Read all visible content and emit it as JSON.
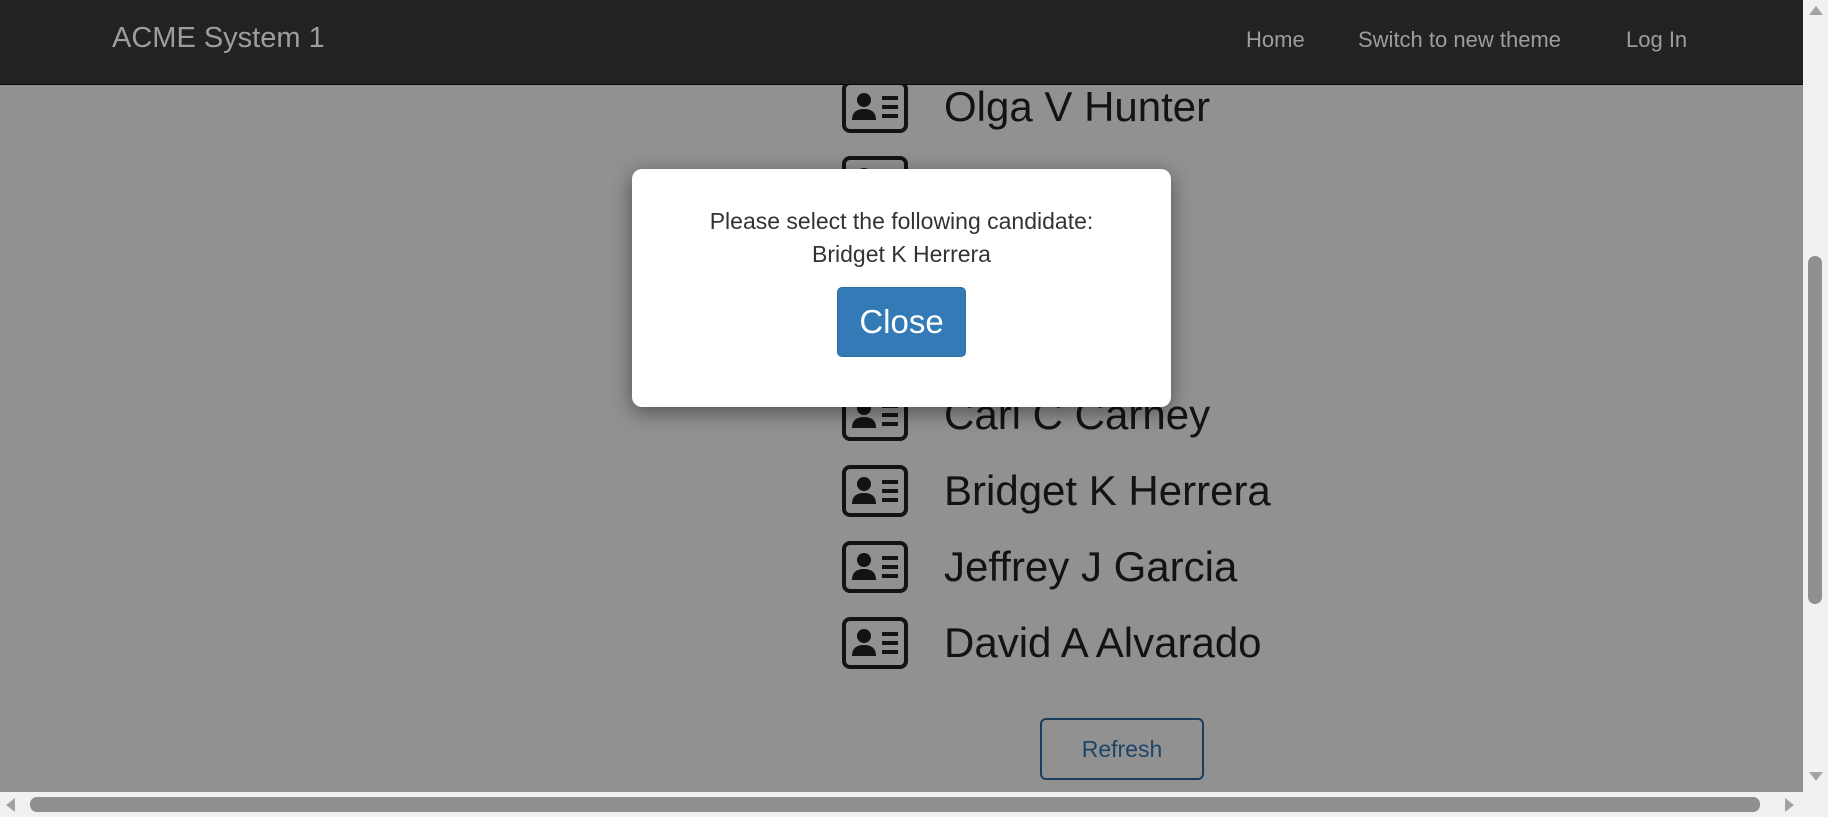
{
  "navbar": {
    "brand": "ACME System 1",
    "links": [
      "Home",
      "Switch to new theme",
      "Log In"
    ]
  },
  "candidates": [
    {
      "name": "Olga V Hunter",
      "icon": "id-card-icon"
    },
    {
      "name": "",
      "icon": "id-card-icon"
    },
    {
      "name": "Carl C Carney",
      "icon": "id-card-icon"
    },
    {
      "name": "Bridget K Herrera",
      "icon": "id-card-icon"
    },
    {
      "name": "Jeffrey J Garcia",
      "icon": "id-card-icon"
    },
    {
      "name": "David A Alvarado",
      "icon": "id-card-icon"
    }
  ],
  "refresh_label": "Refresh",
  "modal": {
    "message": "Please select the following candidate:",
    "candidate": "Bridget K Herrera",
    "close_label": "Close"
  },
  "colors": {
    "navbar_bg": "#222222",
    "primary": "#337ab7",
    "backdrop": "rgba(0,0,0,0.43)"
  }
}
